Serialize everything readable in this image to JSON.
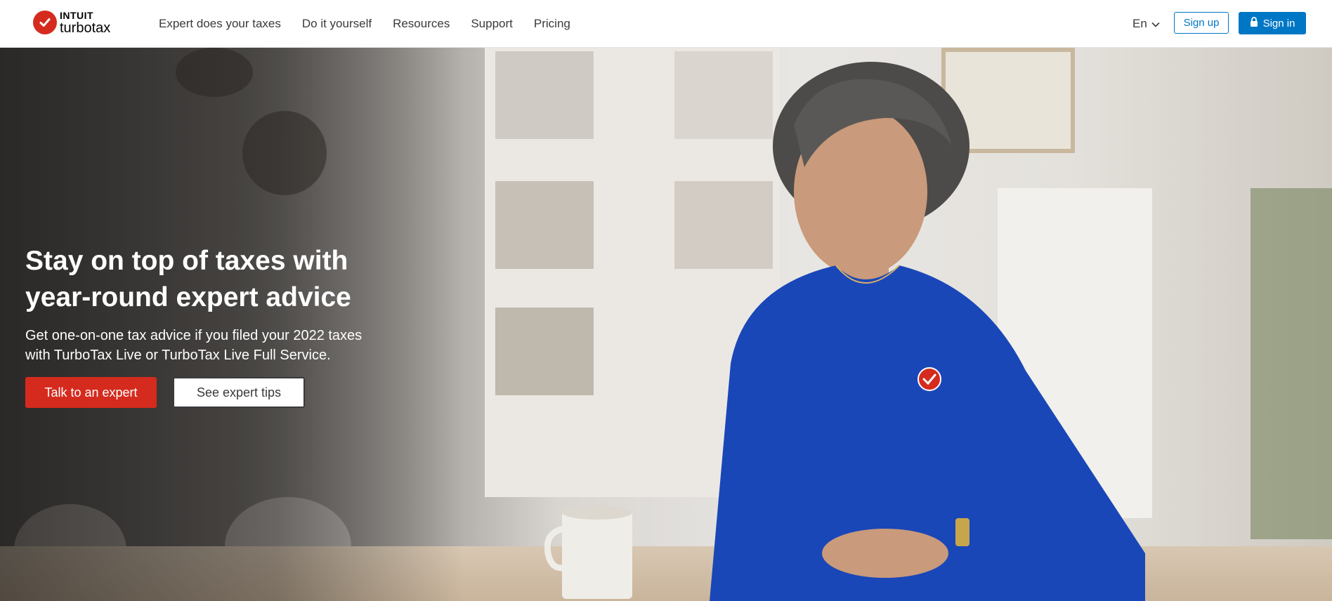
{
  "brand": {
    "intuit": "INTUIT",
    "name": "turbotax",
    "accent": "#d52b1e",
    "link_blue": "#0077c5"
  },
  "nav": {
    "links": [
      {
        "label": "Expert does your taxes"
      },
      {
        "label": "Do it yourself"
      },
      {
        "label": "Resources"
      },
      {
        "label": "Support"
      },
      {
        "label": "Pricing"
      }
    ],
    "language": "En",
    "signup_label": "Sign up",
    "signin_label": "Sign in"
  },
  "hero": {
    "title_line1": "Stay on top of taxes with",
    "title_line2": "year-round expert advice",
    "subtitle_line1": "Get one-on-one tax advice if you filed your 2022 taxes",
    "subtitle_line2": "with TurboTax Live or TurboTax Live Full Service.",
    "primary_cta": "Talk to an expert",
    "secondary_cta": "See expert tips"
  },
  "icons": {
    "logo": "checkmark-circle-icon",
    "language": "chevron-down-icon",
    "signin": "lock-icon"
  }
}
